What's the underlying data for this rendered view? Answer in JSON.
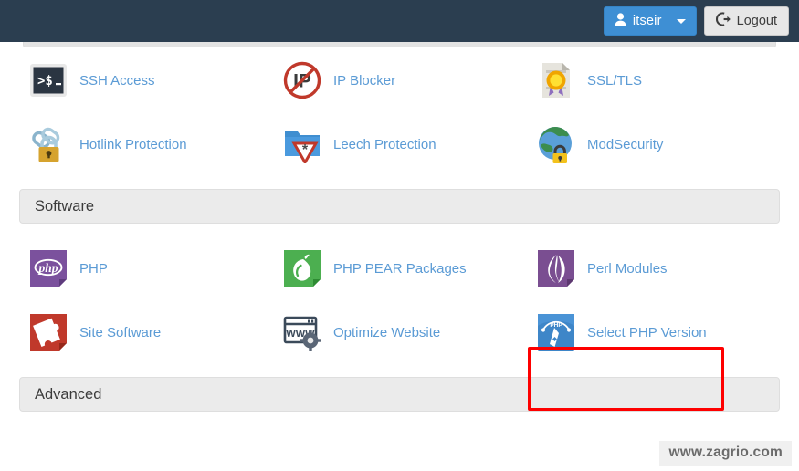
{
  "header": {
    "user_label": "itseir",
    "user_icon": "person-icon",
    "caret_icon": "chevron-down-icon",
    "logout_label": "Logout",
    "logout_icon": "logout-icon",
    "bar_color": "#2b3e50",
    "user_button_color": "#3e8fd4"
  },
  "security_section": {
    "items": [
      {
        "label": "SSH Access",
        "icon": "terminal-icon"
      },
      {
        "label": "IP Blocker",
        "icon": "ip-blocker-icon"
      },
      {
        "label": "SSL/TLS",
        "icon": "certificate-icon"
      },
      {
        "label": "Hotlink Protection",
        "icon": "chain-lock-icon"
      },
      {
        "label": "Leech Protection",
        "icon": "folder-warning-icon"
      },
      {
        "label": "ModSecurity",
        "icon": "globe-lock-icon"
      }
    ]
  },
  "software_section": {
    "title": "Software",
    "items": [
      {
        "label": "PHP",
        "icon": "php-icon"
      },
      {
        "label": "PHP PEAR Packages",
        "icon": "pear-icon"
      },
      {
        "label": "Perl Modules",
        "icon": "perl-onion-icon"
      },
      {
        "label": "Site Software",
        "icon": "puzzle-piece-icon"
      },
      {
        "label": "Optimize Website",
        "icon": "www-gear-icon"
      },
      {
        "label": "Select PHP Version",
        "icon": "php-gauge-icon"
      }
    ]
  },
  "advanced_section": {
    "title": "Advanced"
  },
  "highlight": {
    "target": "Select PHP Version",
    "color": "#fe0000"
  },
  "watermark": {
    "text": "www.zagrio.com"
  }
}
